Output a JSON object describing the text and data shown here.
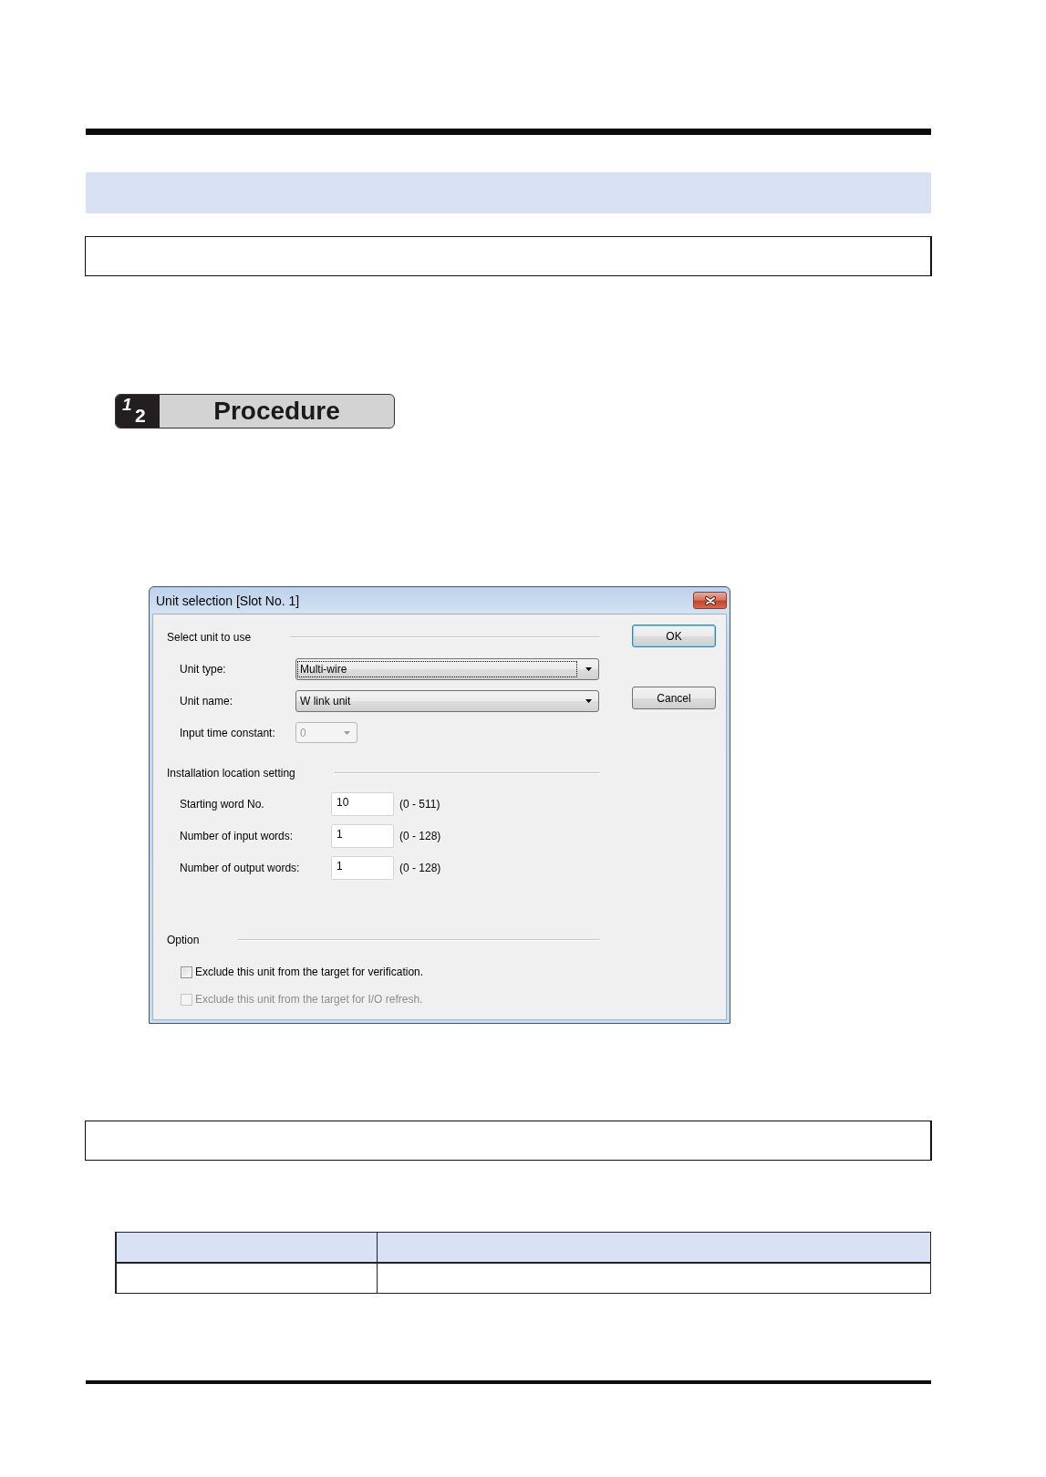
{
  "step_banner": {
    "digits": [
      "1",
      "2"
    ],
    "title": "Procedure"
  },
  "dialog": {
    "title": "Unit selection [Slot No. 1]",
    "sections": [
      {
        "heading": "Select unit to use",
        "fields": [
          {
            "kind": "dropdown",
            "label": "Unit type:",
            "value": "Multi-wire",
            "focused": true,
            "disabled": false
          },
          {
            "kind": "dropdown",
            "label": "Unit name:",
            "value": "W link unit",
            "focused": false,
            "disabled": false
          },
          {
            "kind": "minidropdown",
            "label": "Input time constant:",
            "value": "0",
            "focused": false,
            "disabled": true
          }
        ]
      },
      {
        "heading": "Installation location setting",
        "fields": [
          {
            "kind": "number",
            "label": "Starting word No.",
            "value": "10",
            "range": "(0 - 511)"
          },
          {
            "kind": "number",
            "label": "Number of input words:",
            "value": "1",
            "range": "(0 - 128)"
          },
          {
            "kind": "number",
            "label": "Number of output words:",
            "value": "1",
            "range": "(0 - 128)"
          }
        ]
      },
      {
        "heading": "Option",
        "fields": [
          {
            "kind": "checkbox",
            "label": "Exclude this unit from the target for verification.",
            "checked": false,
            "disabled": false
          },
          {
            "kind": "checkbox",
            "label": "Exclude this unit from the target for I/O refresh.",
            "checked": false,
            "disabled": true
          }
        ]
      }
    ],
    "buttons": [
      {
        "label": "OK",
        "default": true
      },
      {
        "label": "Cancel",
        "default": false
      }
    ]
  }
}
